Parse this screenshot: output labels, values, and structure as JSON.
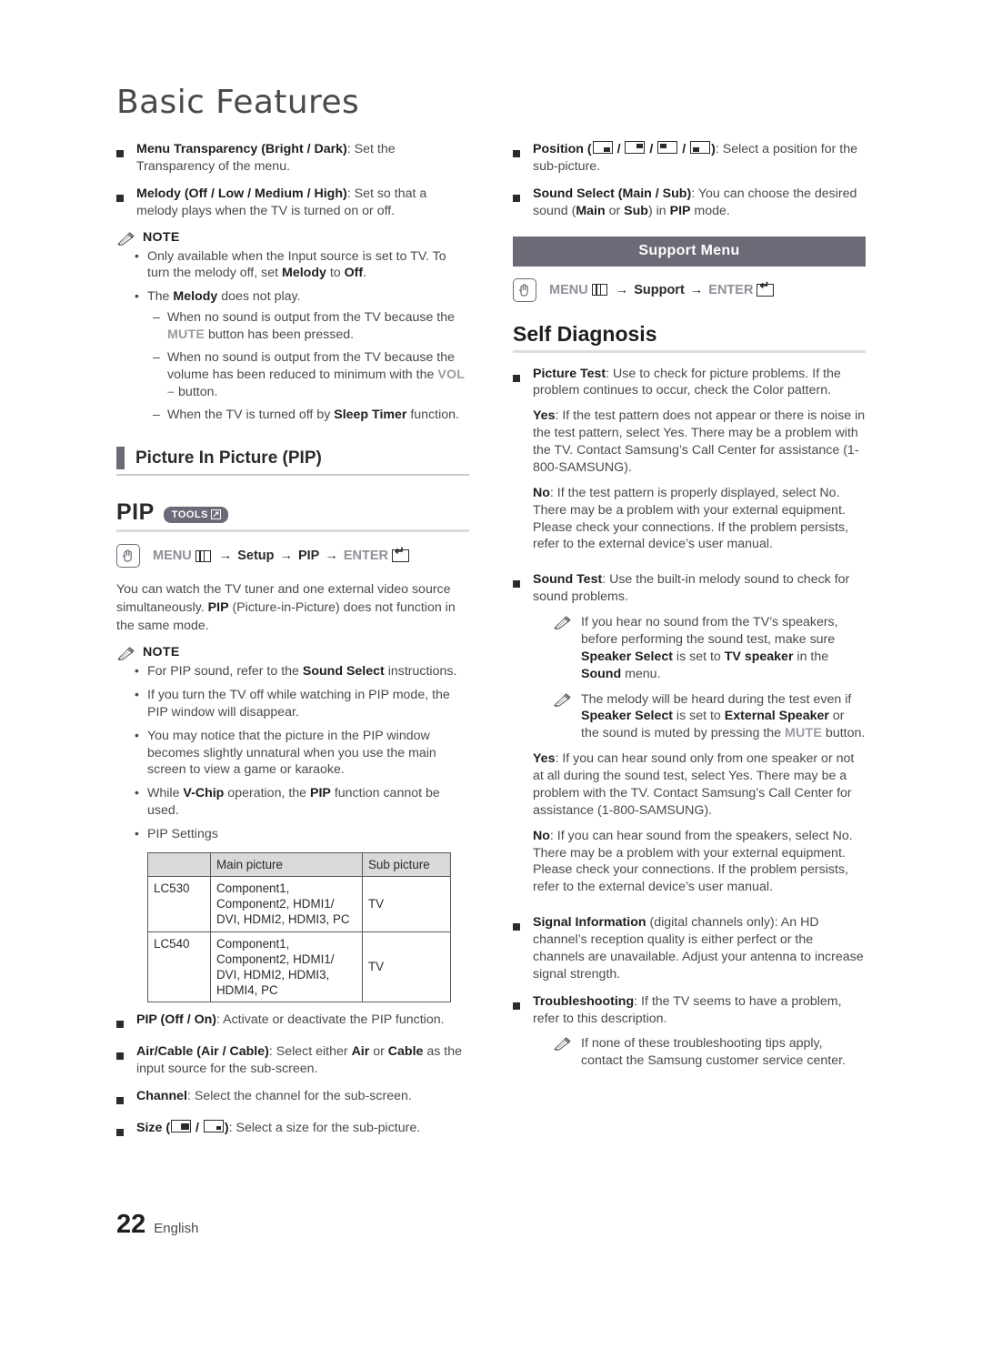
{
  "document": {
    "title": "Basic Features",
    "page_number": "22",
    "language": "English"
  },
  "left_column": {
    "menu_transparency": {
      "bold": "Menu Transparency (Bright / Dark)",
      "rest": ": Set the Transparency of the menu."
    },
    "melody": {
      "bold": "Melody (Off / Low / Medium / High)",
      "rest": ": Set so that a melody plays when the TV is turned on or off."
    },
    "note_label": "NOTE",
    "melody_notes": {
      "item1_a": "Only available when the Input source is set to TV. To turn the melody off, set ",
      "item1_b": "Melody",
      "item1_c": " to ",
      "item1_d": "Off",
      "item1_e": ".",
      "item2_a": "The ",
      "item2_b": "Melody",
      "item2_c": " does not play.",
      "dash1_a": "When no sound is output from the TV because the ",
      "dash1_btn": "MUTE",
      "dash1_b": " button has been pressed.",
      "dash2_a": "When no sound is output from the TV because the volume has been reduced to minimum with the ",
      "dash2_btn": "VOL –",
      "dash2_b": " button.",
      "dash3_a": "When the TV is turned off by ",
      "dash3_b": "Sleep Timer",
      "dash3_c": " function."
    },
    "section_heading": "Picture In Picture (PIP)",
    "pip": {
      "title": "PIP",
      "tools_badge": "TOOLS",
      "nav": {
        "menu": "MENU",
        "setup": "Setup",
        "pip": "PIP",
        "enter": "ENTER"
      },
      "intro_a": "You can watch the TV tuner and one external video source simultaneously. ",
      "intro_b": "PIP",
      "intro_c": " (Picture-in-Picture) does not function in the same mode.",
      "note_label": "NOTE",
      "notes": {
        "n1_a": "For PIP sound, refer to the ",
        "n1_b": "Sound Select",
        "n1_c": " instructions.",
        "n2": "If you turn the TV off while watching in PIP mode, the PIP window will disappear.",
        "n3": "You may notice that the picture in the PIP window becomes slightly unnatural when you use the main screen to view a game or karaoke.",
        "n4_a": "While ",
        "n4_b": "V-Chip",
        "n4_c": " operation, the ",
        "n4_d": "PIP",
        "n4_e": " function cannot be used.",
        "n5": "PIP Settings"
      },
      "table": {
        "headers": [
          "",
          "Main picture",
          "Sub picture"
        ],
        "rows": [
          {
            "model": "LC530",
            "main": "Component1, Component2, HDMI1/ DVI, HDMI2, HDMI3, PC",
            "sub": "TV"
          },
          {
            "model": "LC540",
            "main": "Component1, Component2, HDMI1/ DVI, HDMI2, HDMI3, HDMI4, PC",
            "sub": "TV"
          }
        ]
      }
    },
    "pip_options": {
      "pip_onoff_bold": "PIP (Off / On)",
      "pip_onoff_rest": ": Activate or deactivate the PIP function.",
      "aircable_bold": "Air/Cable (Air / Cable)",
      "aircable_a": ": Select either ",
      "aircable_b": "Air",
      "aircable_c": " or ",
      "aircable_d": "Cable",
      "aircable_e": " as the input source for the sub-screen.",
      "channel_bold": "Channel",
      "channel_rest": ": Select the channel for the sub-screen.",
      "size_bold": "Size",
      "size_open": " (",
      "size_slash": " / ",
      "size_close": ")",
      "size_rest": ": Select a size for the sub-picture."
    }
  },
  "right_column": {
    "position": {
      "bold": "Position",
      "open": " (",
      "sep": " / ",
      "close": ")",
      "rest": ": Select a position for the sub-picture."
    },
    "sound_select": {
      "bold": "Sound Select (Main / Sub)",
      "a": ": You can choose the desired sound (",
      "main": "Main",
      "or": " or ",
      "sub": "Sub",
      "b": ") in ",
      "pip": "PIP",
      "c": " mode."
    },
    "support_menu_bar": "Support Menu",
    "nav": {
      "menu": "MENU",
      "support": "Support",
      "enter": "ENTER"
    },
    "self_diagnosis_heading": "Self Diagnosis",
    "picture_test": {
      "bold": "Picture Test",
      "rest": ": Use to check for picture problems. If the problem continues to occur, check the Color pattern.",
      "yes_label": "Yes",
      "yes_text": ": If the test pattern does not appear or there is noise in the test pattern, select Yes. There may be a problem with the TV. Contact Samsung’s Call Center for assistance (1-800-SAMSUNG).",
      "no_label": "No",
      "no_text": ": If the test pattern is properly displayed, select No. There may be a problem with your external equipment. Please check your connections. If the problem persists, refer to the external device’s user manual."
    },
    "sound_test": {
      "bold": "Sound Test",
      "rest": ": Use the built-in melody sound to check for sound problems.",
      "note1_a": "If you hear no sound from the TV’s speakers, before performing the sound test, make sure ",
      "note1_b": "Speaker Select",
      "note1_c": " is set to ",
      "note1_d": "TV speaker",
      "note1_e": " in the ",
      "note1_f": "Sound",
      "note1_g": " menu.",
      "note2_a": "The melody will be heard during the test even if ",
      "note2_b": "Speaker Select",
      "note2_c": " is set to ",
      "note2_d": "External Speaker",
      "note2_e": " or the sound is muted by pressing the ",
      "note2_btn": "MUTE",
      "note2_f": " button.",
      "yes_label": "Yes",
      "yes_text": ": If you can hear sound only from one speaker or not at all during the sound test, select Yes. There may be a problem with the TV. Contact Samsung’s Call Center for assistance (1-800-SAMSUNG).",
      "no_label": "No",
      "no_text": ": If you can hear sound from the speakers, select No. There may be a problem with your external equipment. Please check your connections. If the problem persists, refer to the external device’s user manual."
    },
    "signal_information": {
      "bold": "Signal Information",
      "rest": " (digital channels only): An HD channel’s reception quality is either perfect or the channels are unavailable. Adjust your antenna to increase signal strength."
    },
    "troubleshooting": {
      "bold": "Troubleshooting",
      "rest": ": If the TV seems to have a problem, refer to this description.",
      "note": "If none of these troubleshooting tips apply, contact the Samsung customer service center."
    }
  },
  "colors": {
    "accent_bar": "#6b6b78",
    "table_header": "#d9d9d9",
    "button_name": "#9a9aa2",
    "text": "#4a4a4a"
  }
}
